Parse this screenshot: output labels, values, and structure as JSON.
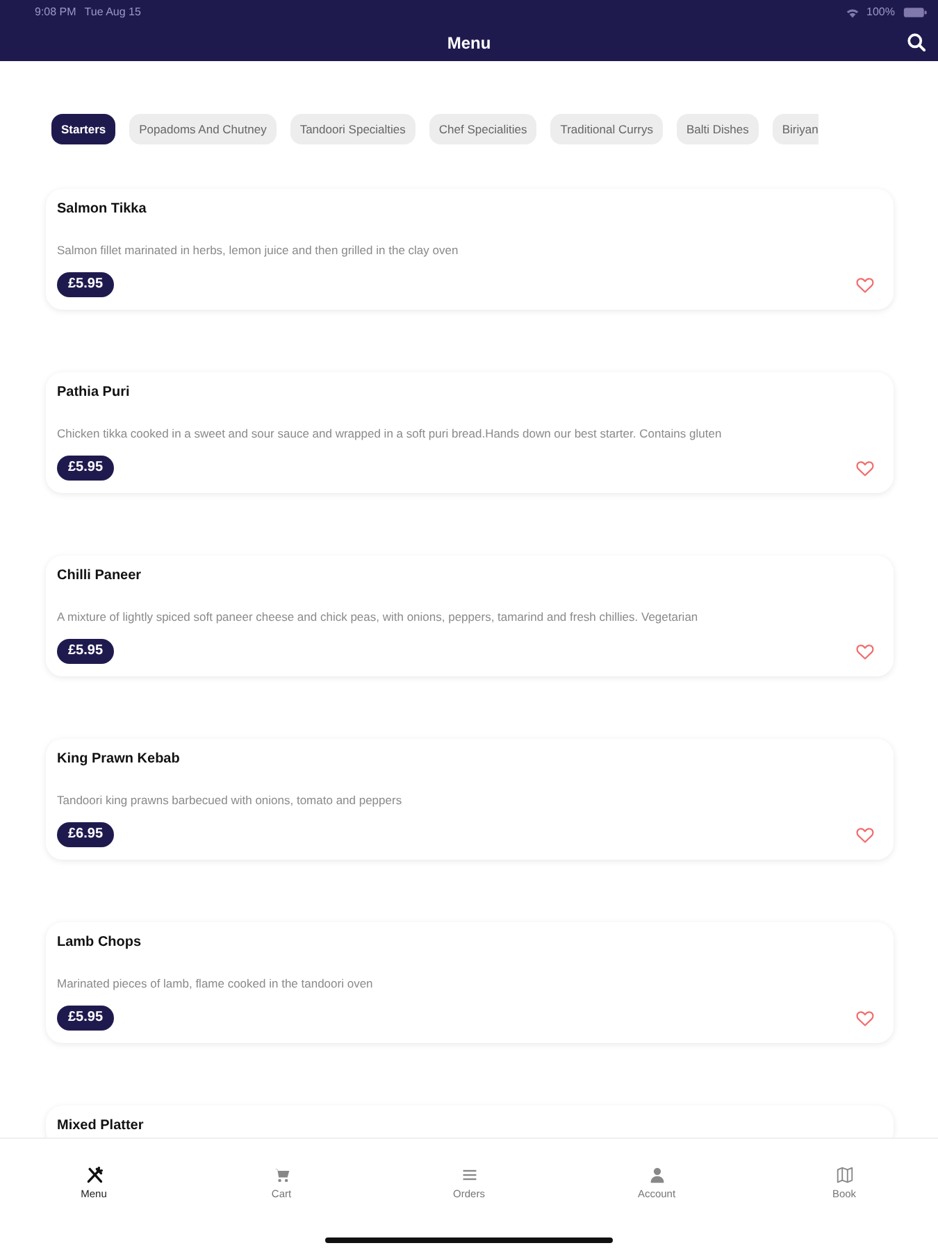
{
  "status_bar": {
    "time": "9:08 PM",
    "date": "Tue Aug 15",
    "battery": "100%"
  },
  "header": {
    "title": "Menu"
  },
  "categories": [
    {
      "label": "Starters",
      "selected": true
    },
    {
      "label": "Popadoms And Chutney",
      "selected": false
    },
    {
      "label": "Tandoori Specialties",
      "selected": false
    },
    {
      "label": "Chef Specialities",
      "selected": false
    },
    {
      "label": "Traditional Currys",
      "selected": false
    },
    {
      "label": "Balti Dishes",
      "selected": false
    },
    {
      "label": "Biriyan",
      "selected": false
    }
  ],
  "items": [
    {
      "name": "Salmon Tikka",
      "description": "Salmon fillet marinated in herbs, lemon juice and then grilled in the clay oven",
      "price": "£5.95"
    },
    {
      "name": "Pathia Puri",
      "description": "Chicken tikka cooked in a sweet and sour sauce and wrapped in a soft puri bread.Hands down our best starter. Contains gluten",
      "price": "£5.95"
    },
    {
      "name": "Chilli Paneer",
      "description": "A mixture of lightly spiced soft paneer cheese and chick peas, with onions, peppers, tamarind and fresh chillies. Vegetarian",
      "price": "£5.95"
    },
    {
      "name": "King Prawn Kebab",
      "description": "Tandoori king prawns barbecued with onions, tomato and peppers",
      "price": "£6.95"
    },
    {
      "name": "Lamb Chops",
      "description": "Marinated pieces of lamb, flame cooked in the tandoori oven",
      "price": "£5.95"
    },
    {
      "name": "Mixed Platter"
    }
  ],
  "tab_bar": [
    {
      "label": "Menu",
      "kind": "utensils",
      "selected": true
    },
    {
      "label": "Cart",
      "kind": "cart",
      "selected": false
    },
    {
      "label": "Orders",
      "kind": "list",
      "selected": false
    },
    {
      "label": "Account",
      "kind": "person",
      "selected": false
    },
    {
      "label": "Book",
      "kind": "map",
      "selected": false
    }
  ]
}
